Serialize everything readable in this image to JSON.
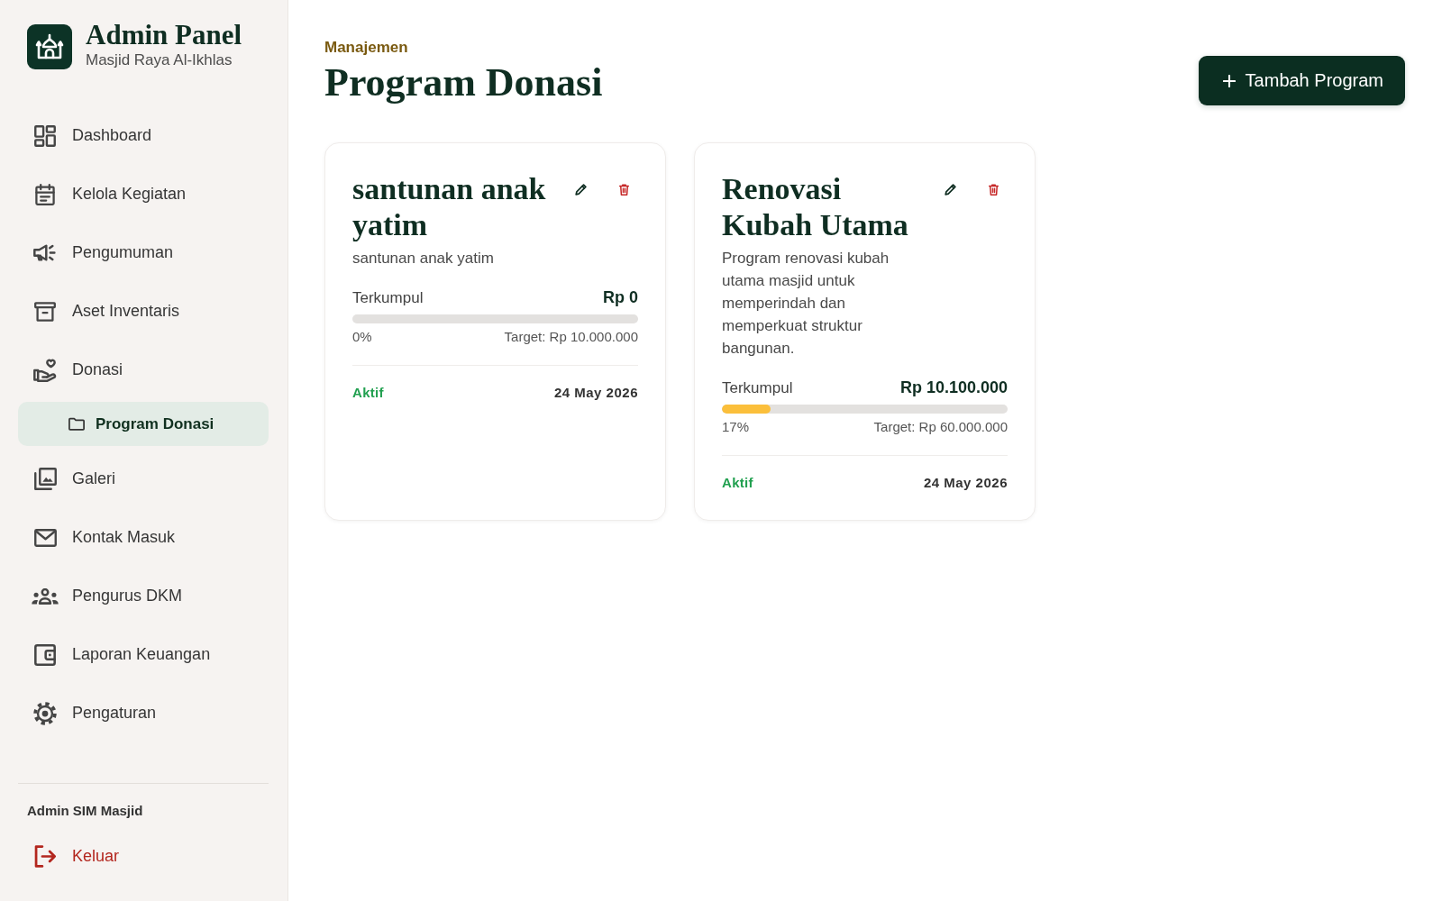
{
  "sidebar": {
    "brand": {
      "title": "Admin Panel",
      "subtitle": "Masjid Raya Al-Ikhlas"
    },
    "nav": [
      {
        "label": "Dashboard",
        "selected": false
      },
      {
        "label": "Kelola Kegiatan",
        "selected": false
      },
      {
        "label": "Pengumuman",
        "selected": false
      },
      {
        "label": "Aset Inventaris",
        "selected": false
      },
      {
        "label": "Donasi",
        "selected": false,
        "children": [
          {
            "label": "Program Donasi",
            "selected": true
          }
        ]
      },
      {
        "label": "Galeri",
        "selected": false
      },
      {
        "label": "Kontak Masuk",
        "selected": false
      },
      {
        "label": "Pengurus DKM",
        "selected": false
      },
      {
        "label": "Laporan Keuangan",
        "selected": false
      },
      {
        "label": "Pengaturan",
        "selected": false
      }
    ],
    "user": "Admin SIM Masjid",
    "logout": "Keluar"
  },
  "header": {
    "eyebrow": "Manajemen",
    "title": "Program Donasi",
    "add_button": "Tambah Program"
  },
  "programs": [
    {
      "title": "santunan anak yatim",
      "description": "santunan anak yatim",
      "collected_label": "Terkumpul",
      "collected": "Rp 0",
      "level": 0,
      "percent": "0%",
      "target": "Target: Rp 10.000.000",
      "status": "Aktif",
      "active": true,
      "date": "24 May 2026"
    },
    {
      "title": "Renovasi Kubah Utama",
      "description": "Program renovasi kubah utama masjid untuk memperindah dan memperkuat struktur bangunan.",
      "collected_label": "Terkumpul",
      "collected": "Rp 10.100.000",
      "level": 0.17,
      "percent": "17%",
      "target": "Target: Rp 60.000.000",
      "status": "Aktif",
      "active": true,
      "date": "24 May 2026"
    }
  ]
}
